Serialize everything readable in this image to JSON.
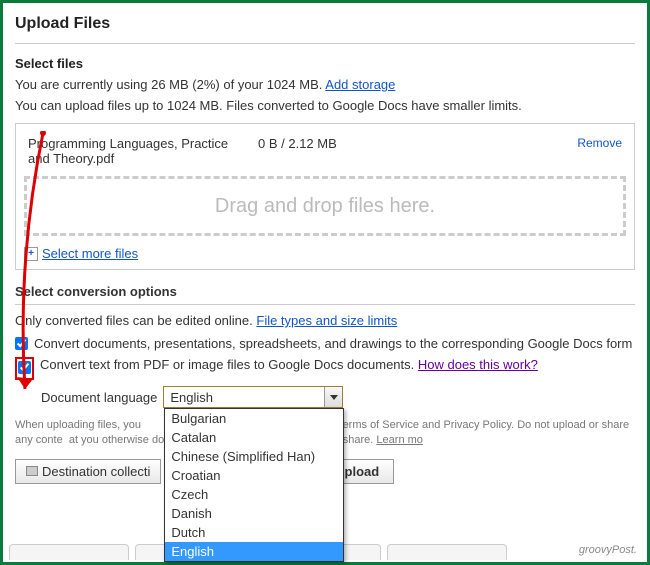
{
  "header": {
    "title": "Upload Files"
  },
  "select_files": {
    "heading": "Select files",
    "storage_text_prefix": "You are currently using ",
    "storage_used": "26 MB",
    "storage_pct": " (2%) ",
    "storage_text_mid": "of your ",
    "storage_total": "1024 MB",
    "storage_text_suffix": ". ",
    "add_storage_link": "Add storage",
    "upload_limit_text": "You can upload files up to 1024 MB. Files converted to Google Docs have smaller limits."
  },
  "file": {
    "name": "Programming Languages, Practice and Theory.pdf",
    "progress": "0 B / 2.12 MB",
    "remove_label": "Remove"
  },
  "drop_zone_text": "Drag and drop files here.",
  "select_more_label": "Select more files",
  "conversion": {
    "heading": "Select conversion options",
    "only_converted": "Only converted files can be edited online. ",
    "file_types_link": "File types and size limits",
    "convert_docs": "Convert documents, presentations, spreadsheets, and drawings to the corresponding Google Docs form",
    "convert_pdf": "Convert text from PDF or image files to Google Docs documents. ",
    "how_link": "How does this work?",
    "lang_label": "Document language",
    "lang_selected": "English",
    "lang_options": [
      "Bulgarian",
      "Catalan",
      "Chinese (Simplified Han)",
      "Croatian",
      "Czech",
      "Danish",
      "Dutch",
      "English"
    ]
  },
  "disclaimer": {
    "text_1": "When uploading files, you",
    "text_2": "ocs Terms of Service and Privacy Policy. Do not upload or share any conte",
    "text_3": "at you otherwise do not have the legal right to upload or share. ",
    "learn_more": "Learn mo"
  },
  "buttons": {
    "destination": "Destination collecti",
    "start_upload": "art upload"
  },
  "watermark": "groovyPost."
}
